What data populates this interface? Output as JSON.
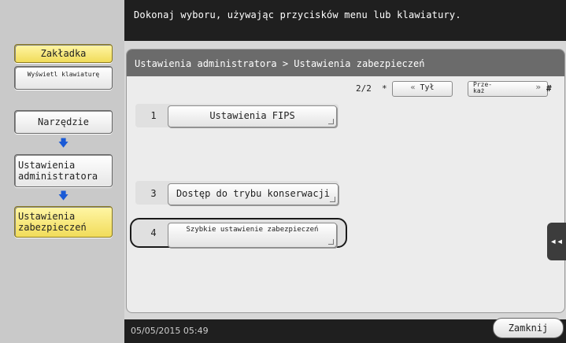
{
  "header": {
    "message": "Dokonaj wyboru, używając przycisków menu lub klawiatury."
  },
  "sidebar": {
    "bookmark": "Zakładka",
    "show_keyboard": "Wyświetl klawiaturę",
    "nav": [
      {
        "label": "Narzędzie"
      },
      {
        "label": "Ustawienia administratora"
      },
      {
        "label": "Ustawienia zabezpieczeń"
      }
    ]
  },
  "breadcrumb": "Ustawienia administratora > Ustawienia zabezpieczeń",
  "pager": {
    "page": "2/2",
    "star": "*",
    "back_label": "Tył",
    "next_label": "Prze- każ",
    "hash": "#"
  },
  "items": [
    {
      "num": "1",
      "label": "Ustawienia FIPS"
    },
    {
      "num": "3",
      "label": "Dostęp do trybu konserwacji"
    },
    {
      "num": "4",
      "label": "Szybkie ustawienie zabezpieczeń"
    }
  ],
  "footer": {
    "datetime": "05/05/2015  05:49",
    "close_label": "Zamknij"
  },
  "icons": {
    "side_tab": "double-chevron-left-icon",
    "arrow": "arrow-down-icon"
  },
  "colors": {
    "accent_yellow": "#f1dc5a",
    "arrow_blue": "#1a5ad6"
  }
}
